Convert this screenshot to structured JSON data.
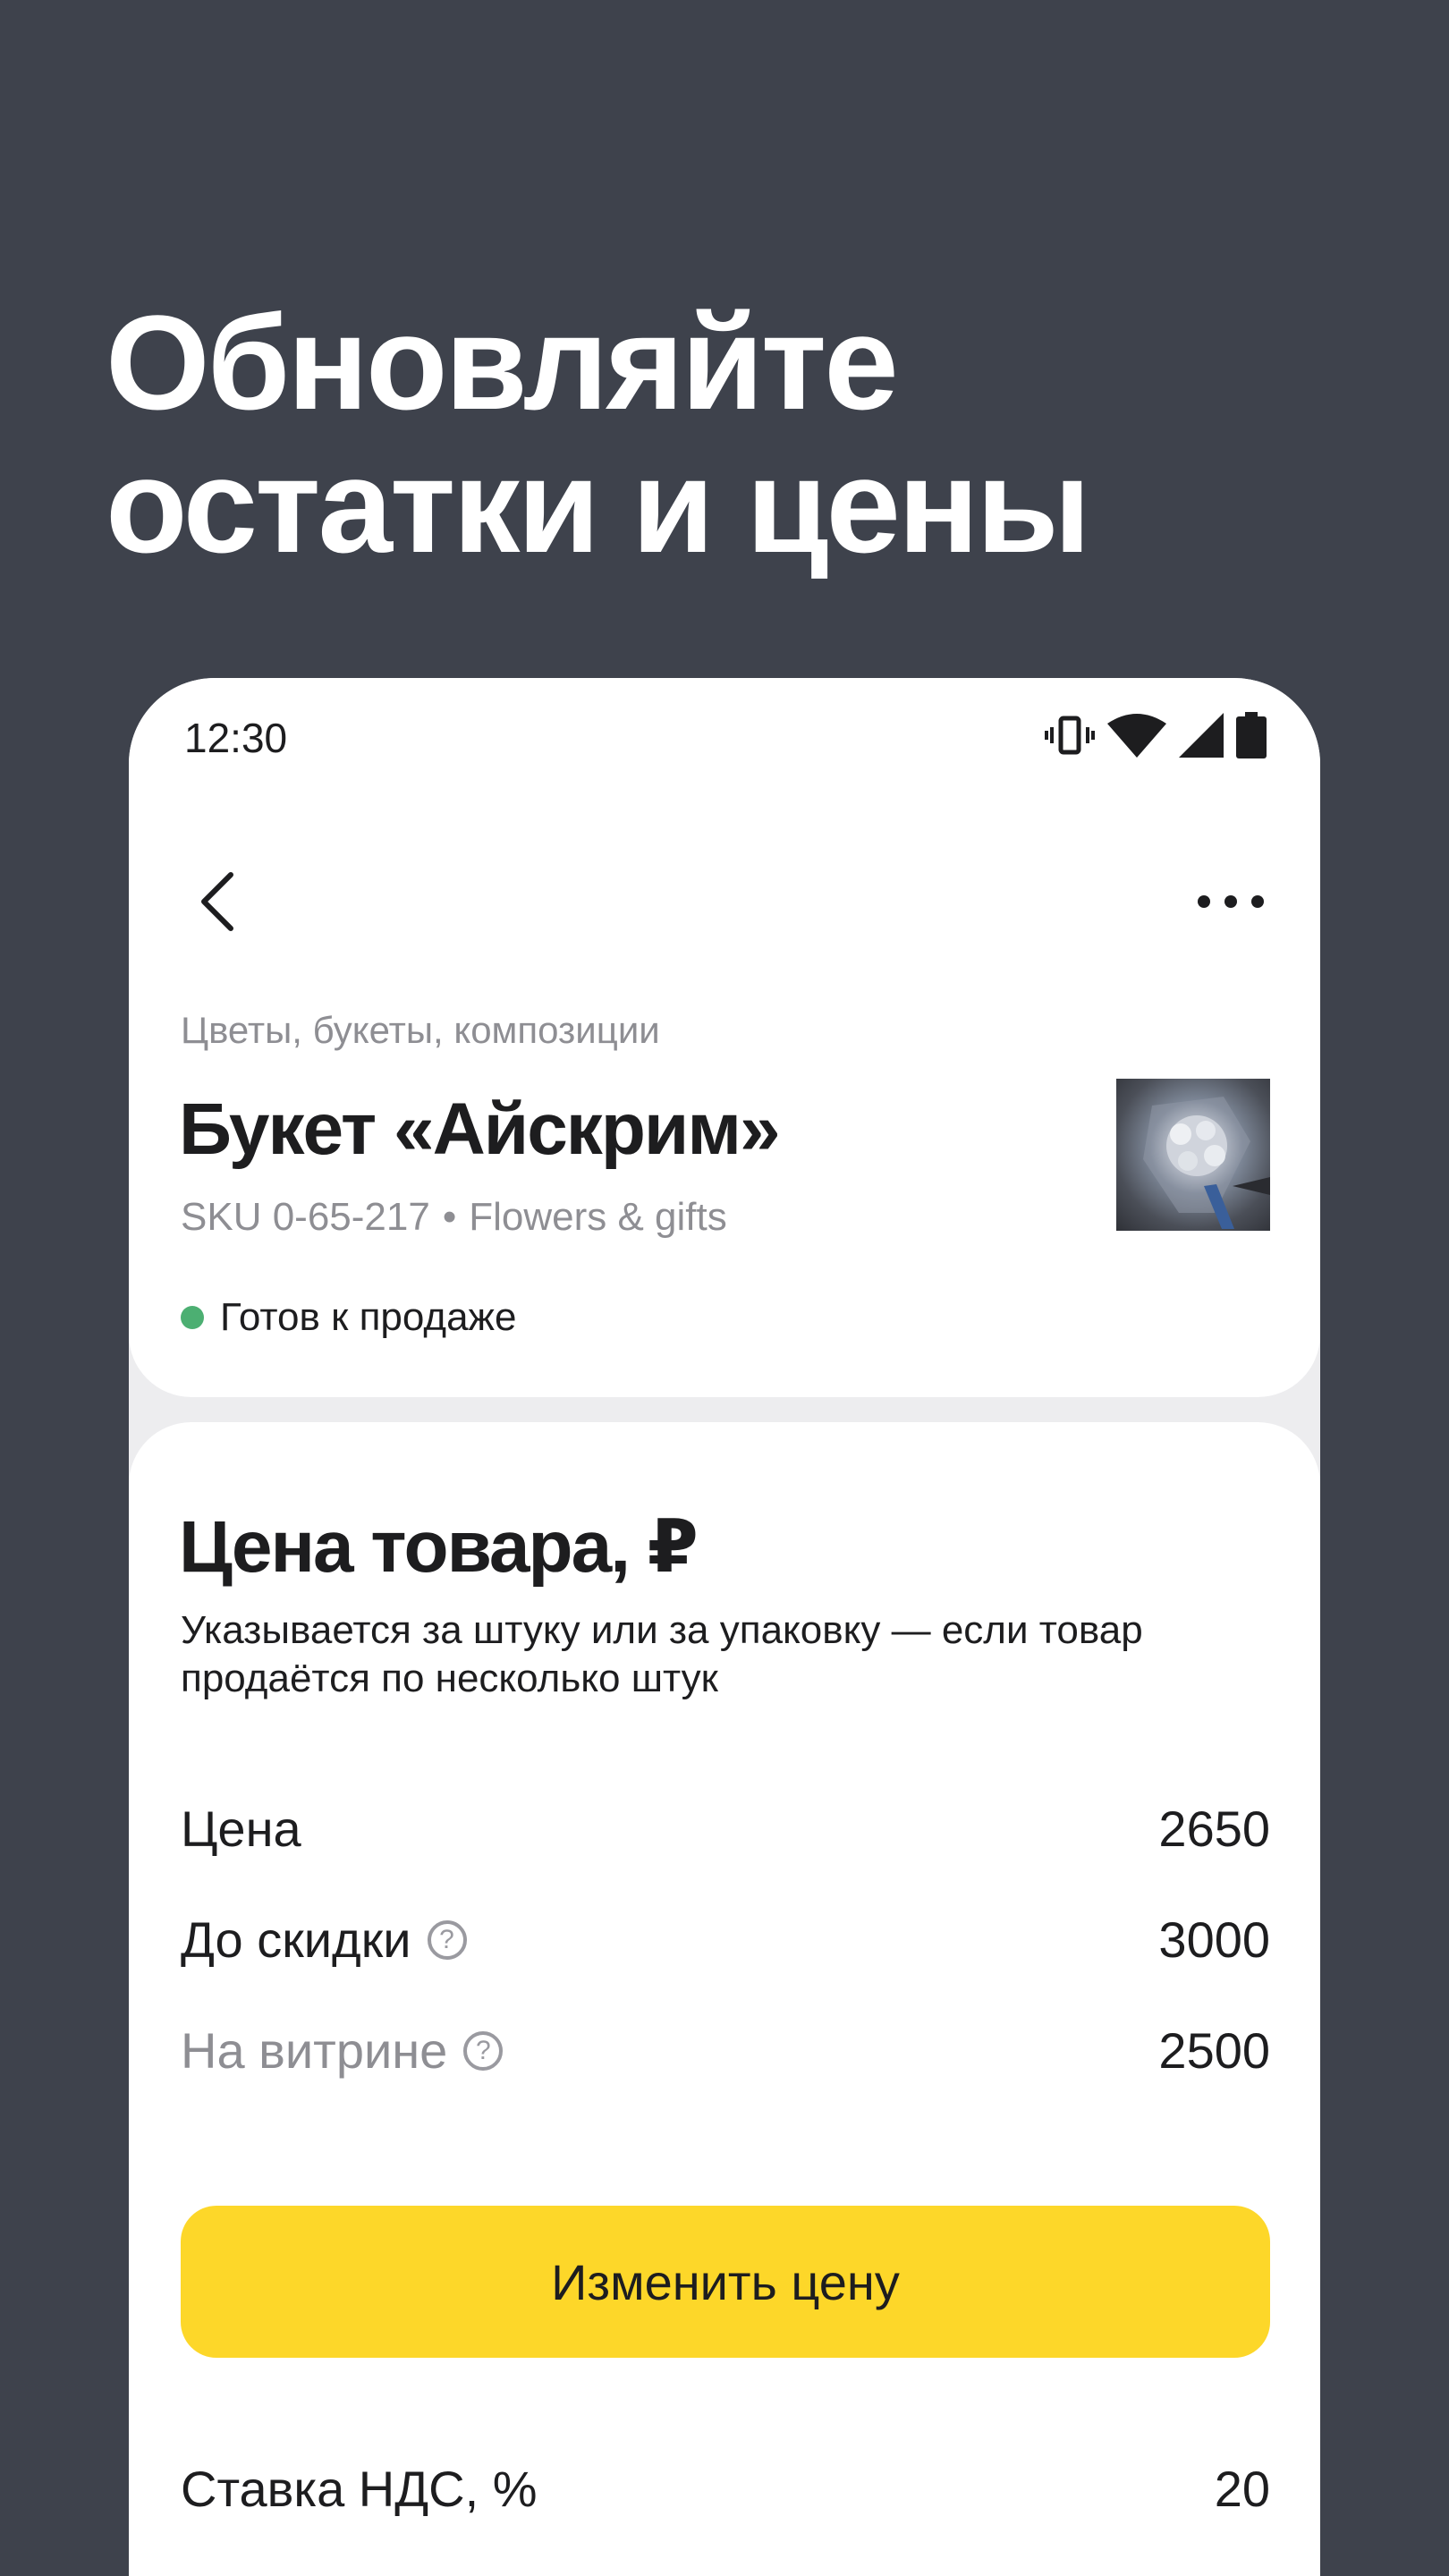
{
  "promo": {
    "headline_line1": "Обновляйте",
    "headline_line2": "остатки и цены"
  },
  "status_bar": {
    "time": "12:30",
    "icons": [
      "vibrate-icon",
      "wifi-icon",
      "signal-icon",
      "battery-icon"
    ]
  },
  "product": {
    "category": "Цветы, букеты, композиции",
    "title": "Букет «Айскрим»",
    "sku": "SKU 0-65-217",
    "separator": "•",
    "shop": "Flowers & gifts",
    "status": "Готов к продаже",
    "status_color": "#4caf72"
  },
  "price_section": {
    "title": "Цена товара, ₽",
    "description": "Указывается за штуку или за упаковку — если товар продаётся по несколько штук",
    "rows": [
      {
        "label": "Цена",
        "value": "2650"
      },
      {
        "label": "До скидки",
        "value": "3000"
      },
      {
        "label": "На витрине",
        "value": "2500"
      }
    ],
    "help_glyph": "?",
    "button_label": "Изменить цену",
    "vat_label": "Ставка НДС, %",
    "vat_value": "20"
  },
  "colors": {
    "background": "#3e424c",
    "accent_button": "#fdd729"
  }
}
